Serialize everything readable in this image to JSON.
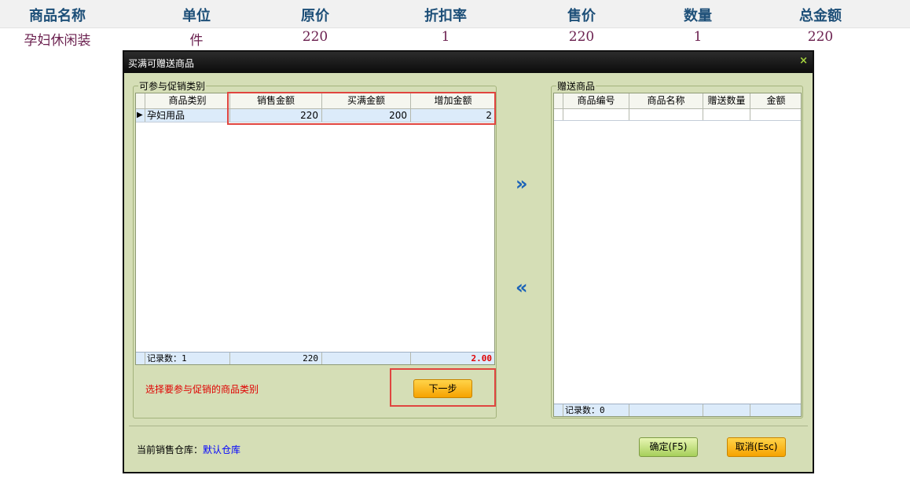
{
  "background_table": {
    "headers": [
      "商品名称",
      "单位",
      "原价",
      "折扣率",
      "售价",
      "数量",
      "总金额"
    ],
    "row": [
      "孕妇休闲装",
      "件",
      "220",
      "1",
      "220",
      "1",
      "220"
    ]
  },
  "dialog": {
    "title": "买满可赠送商品",
    "close_icon": "×",
    "left_group": {
      "label": "可参与促销类别",
      "columns": [
        "商品类别",
        "销售金额",
        "买满金额",
        "增加金额"
      ],
      "rows": [
        {
          "pointer": "▶",
          "category": "孕妇用品",
          "sales_amount": "220",
          "threshold": "200",
          "increase": "2"
        }
      ],
      "footer": {
        "record_count": "记录数：1",
        "sales_total": "220",
        "threshold_total": "",
        "increase_total": "2.00"
      },
      "hint": "选择要参与促销的商品类别",
      "next_button": "下一步"
    },
    "move_right_icon": "»",
    "move_left_icon": "«",
    "right_group": {
      "label": "赠送商品",
      "columns": [
        "商品编号",
        "商品名称",
        "赠送数量",
        "金额"
      ],
      "footer": {
        "record_count": "记录数：0"
      }
    },
    "warehouse_label": "当前销售仓库：",
    "warehouse_value": "默认仓库",
    "confirm_button": "确定(F5)",
    "cancel_button": "取消(Esc)"
  },
  "colors": {
    "dialog_bg": "#d5deb6",
    "header_text": "#1d4f78",
    "row_text": "#6a1f4e",
    "highlight_box": "#e0453f",
    "hint_text": "#e00000",
    "link_text": "#0000ff"
  }
}
